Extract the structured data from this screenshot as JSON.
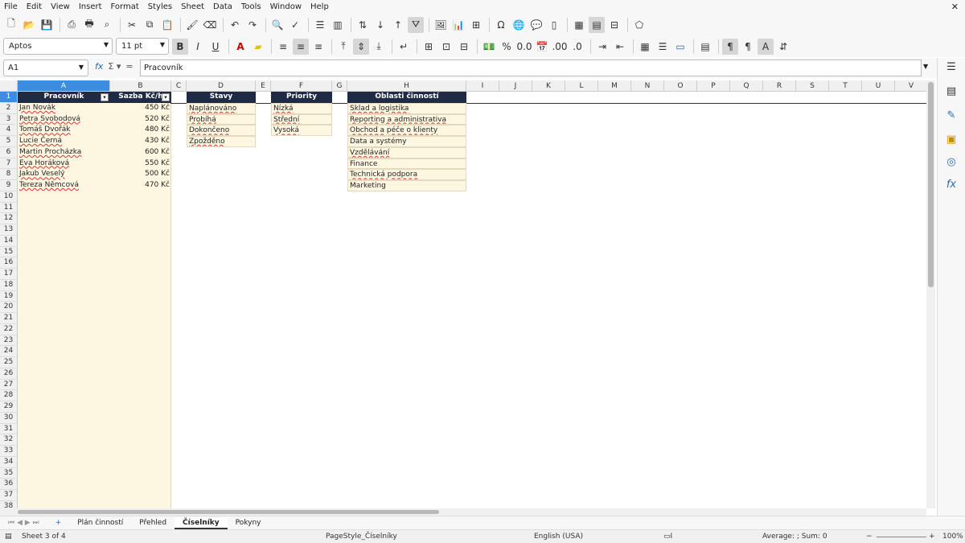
{
  "menu": [
    "File",
    "Edit",
    "View",
    "Insert",
    "Format",
    "Styles",
    "Sheet",
    "Data",
    "Tools",
    "Window",
    "Help"
  ],
  "font": {
    "name": "Aptos",
    "size": "11 pt"
  },
  "namebox": "A1",
  "formula": "Pracovník",
  "columns": [
    "A",
    "B",
    "C",
    "D",
    "E",
    "F",
    "G",
    "H",
    "I",
    "J",
    "K",
    "L",
    "M",
    "N",
    "O",
    "P",
    "Q",
    "R",
    "S",
    "T",
    "U",
    "V"
  ],
  "rows": [
    "1",
    "2",
    "3",
    "4",
    "5",
    "6",
    "7",
    "8",
    "9",
    "10",
    "11",
    "12",
    "13",
    "14",
    "15",
    "16",
    "17",
    "18",
    "19",
    "20",
    "21",
    "22",
    "23",
    "24",
    "25",
    "26",
    "27",
    "28",
    "29",
    "30",
    "31",
    "32",
    "33",
    "34",
    "35",
    "36",
    "37",
    "38"
  ],
  "table_workers": {
    "headers": [
      "Pracovník",
      "Sazba Kč/h"
    ],
    "rows": [
      [
        "Jan Novák",
        "450 Kč"
      ],
      [
        "Petra Svobodová",
        "520 Kč"
      ],
      [
        "Tomáš Dvořák",
        "480 Kč"
      ],
      [
        "Lucie Černá",
        "430 Kč"
      ],
      [
        "Martin Procházka",
        "600 Kč"
      ],
      [
        "Eva Horáková",
        "550 Kč"
      ],
      [
        "Jakub Veselý",
        "500 Kč"
      ],
      [
        "Tereza Němcová",
        "470 Kč"
      ]
    ]
  },
  "table_states": {
    "header": "Stavy",
    "items": [
      "Naplánováno",
      "Probíhá",
      "Dokončeno",
      "Zpožděno"
    ]
  },
  "table_priority": {
    "header": "Priority",
    "items": [
      "Nízká",
      "Střední",
      "Vysoká"
    ]
  },
  "table_areas": {
    "header": "Oblasti činností",
    "items": [
      "Sklad a logistika",
      "Reporting a administrativa",
      "Obchod a péče o klienty",
      "Data a systémy",
      "Vzdělávání",
      "Finance",
      "Technická podpora",
      "Marketing"
    ]
  },
  "tabs": [
    "Plán činností",
    "Přehled",
    "Číselníky",
    "Pokyny"
  ],
  "active_tab": "Číselníky",
  "status": {
    "sheet": "Sheet 3 of 4",
    "pagestyle": "PageStyle_Číselníky",
    "language": "English (USA)",
    "summary": "Average: ; Sum: 0",
    "zoom": "100%"
  },
  "colors": {
    "header_bg": "#1f2a44",
    "cell_fill": "#fdf6e0",
    "selection": "#3c8de0"
  }
}
